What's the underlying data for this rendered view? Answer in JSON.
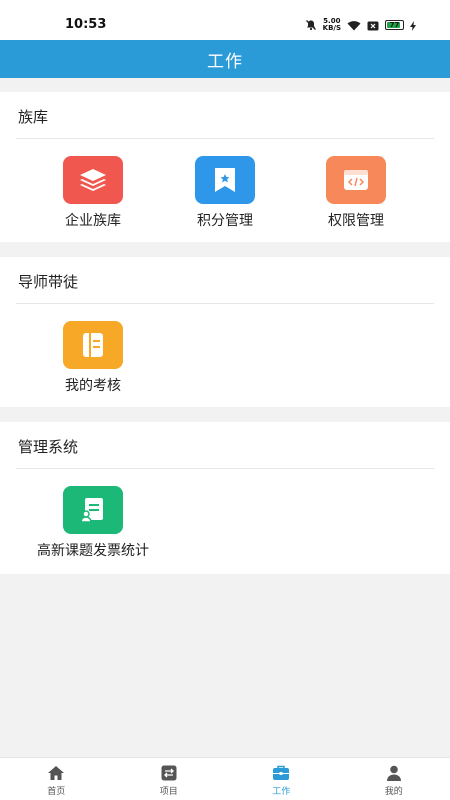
{
  "status_bar": {
    "time": "10:53",
    "net_speed_top": "5.00",
    "net_speed_bottom": "KB/S",
    "battery_level": "77",
    "battery_percent": 77,
    "icons": [
      "mute-icon",
      "wifi-icon",
      "sim-icon",
      "battery-icon",
      "charging-icon"
    ]
  },
  "header": {
    "title": "工作",
    "background": "#2b9bd8"
  },
  "sections": [
    {
      "title": "族库",
      "items": [
        {
          "label": "企业族库",
          "icon": "layers-icon",
          "color": "#f0574e"
        },
        {
          "label": "积分管理",
          "icon": "bookmark-star-icon",
          "color": "#2f97ea"
        },
        {
          "label": "权限管理",
          "icon": "code-window-icon",
          "color": "#f7885a"
        }
      ]
    },
    {
      "title": "导师带徒",
      "items": [
        {
          "label": "我的考核",
          "icon": "notebook-icon",
          "color": "#f7a826"
        }
      ]
    },
    {
      "title": "管理系统",
      "items": [
        {
          "label": "高新课题发票统计",
          "icon": "invoice-icon",
          "color": "#1cb878"
        }
      ]
    }
  ],
  "tabbar": {
    "active_color": "#2b9bd8",
    "tabs": [
      {
        "label": "首页",
        "icon": "home-icon"
      },
      {
        "label": "项目",
        "icon": "swap-icon"
      },
      {
        "label": "工作",
        "icon": "briefcase-icon",
        "active": true
      },
      {
        "label": "我的",
        "icon": "user-icon"
      }
    ]
  }
}
